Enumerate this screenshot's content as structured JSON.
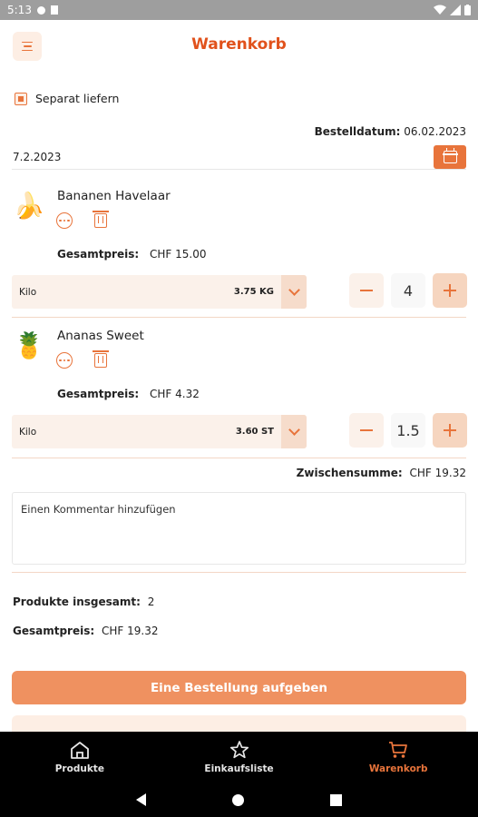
{
  "status_bar": {
    "time": "5:13"
  },
  "header": {
    "title": "Warenkorb"
  },
  "separate_delivery": {
    "label": "Separat liefern",
    "checked": true
  },
  "order_date": {
    "label": "Bestelldatum:",
    "value": "06.02.2023"
  },
  "date_input": {
    "value": "7.2.2023"
  },
  "products": [
    {
      "name": "Bananen Havelaar",
      "image_icon": "banana",
      "total_label": "Gesamtpreis:",
      "total_value": "CHF 15.00",
      "unit": "Kilo",
      "unit_quantity": "3.75 KG",
      "quantity": "4"
    },
    {
      "name": "Ananas Sweet",
      "image_icon": "pineapple",
      "total_label": "Gesamtpreis:",
      "total_value": "CHF 4.32",
      "unit": "Kilo",
      "unit_quantity": "3.60 ST",
      "quantity": "1.5"
    }
  ],
  "subtotal": {
    "label": "Zwischensumme:",
    "value": "CHF 19.32"
  },
  "comment": {
    "placeholder": "Einen Kommentar hinzufügen"
  },
  "summary": {
    "products_label": "Produkte insgesamt:",
    "products_value": "2",
    "total_label": "Gesamtpreis:",
    "total_value": "CHF 19.32"
  },
  "order_button": {
    "label": "Eine Bestellung aufgeben"
  },
  "bottom_nav": [
    {
      "label": "Produkte",
      "icon": "home-icon",
      "active": false
    },
    {
      "label": "Einkaufsliste",
      "icon": "star-icon",
      "active": false
    },
    {
      "label": "Warenkorb",
      "icon": "cart-icon",
      "active": true
    }
  ],
  "colors": {
    "accent": "#e8743b",
    "title": "#e1521c",
    "button": "#ef9160"
  }
}
